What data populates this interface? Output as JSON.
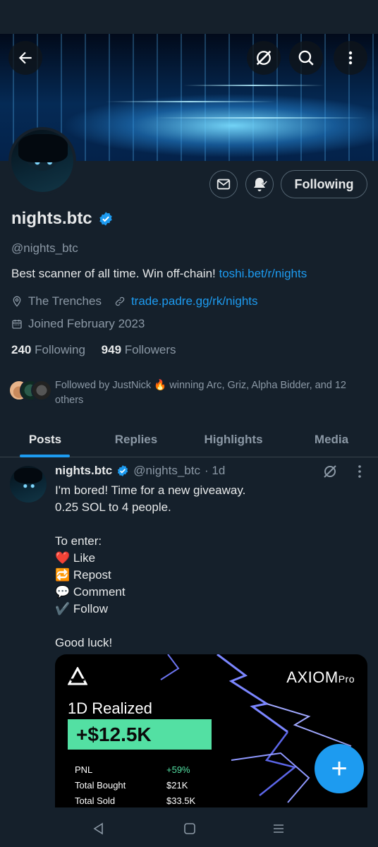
{
  "profile": {
    "name": "nights.btc",
    "handle": "@nights_btc",
    "bio_text": "Best scanner of all time. Win off-chain! ",
    "bio_link": "toshi.bet/r/nights",
    "location": "The Trenches",
    "website": "trade.padre.gg/rk/nights",
    "joined": "Joined February 2023",
    "following_count": "240",
    "following_label": "Following",
    "followers_count": "949",
    "followers_label": "Followers",
    "followed_by": "Followed by JustNick 🔥 winning Arc, Griz, Alpha Bidder, and 12 others",
    "follow_button": "Following"
  },
  "tabs": [
    {
      "label": "Posts",
      "active": true
    },
    {
      "label": "Replies",
      "active": false
    },
    {
      "label": "Highlights",
      "active": false
    },
    {
      "label": "Media",
      "active": false
    }
  ],
  "tweet": {
    "name": "nights.btc",
    "handle": "@nights_btc",
    "time": "· 1d",
    "lines": [
      "I'm bored! Time for a new giveaway.",
      "0.25 SOL to 4 people.",
      "",
      "To enter:",
      "❤️ Like",
      "🔁 Repost",
      "💬 Comment",
      "✔️ Follow",
      "",
      "Good luck!"
    ],
    "card": {
      "brand": "AXIOM",
      "brand_suffix": "Pro",
      "title": "1D Realized",
      "amount": "+$12.5K",
      "rows": [
        {
          "label": "PNL",
          "value": "+59%"
        },
        {
          "label": "Total Bought",
          "value": "$21K"
        },
        {
          "label": "Total Sold",
          "value": "$33.5K"
        }
      ]
    }
  },
  "fab_label": "+",
  "colors": {
    "background": "#15202b",
    "accent": "#1d9bf0",
    "muted": "#8b98a5",
    "pnl_green": "#53e0a3"
  },
  "icons": [
    "back-arrow-icon",
    "grok-icon",
    "search-icon",
    "more-icon",
    "mail-icon",
    "bell-icon",
    "verified-badge-icon",
    "location-icon",
    "link-icon",
    "calendar-icon"
  ]
}
